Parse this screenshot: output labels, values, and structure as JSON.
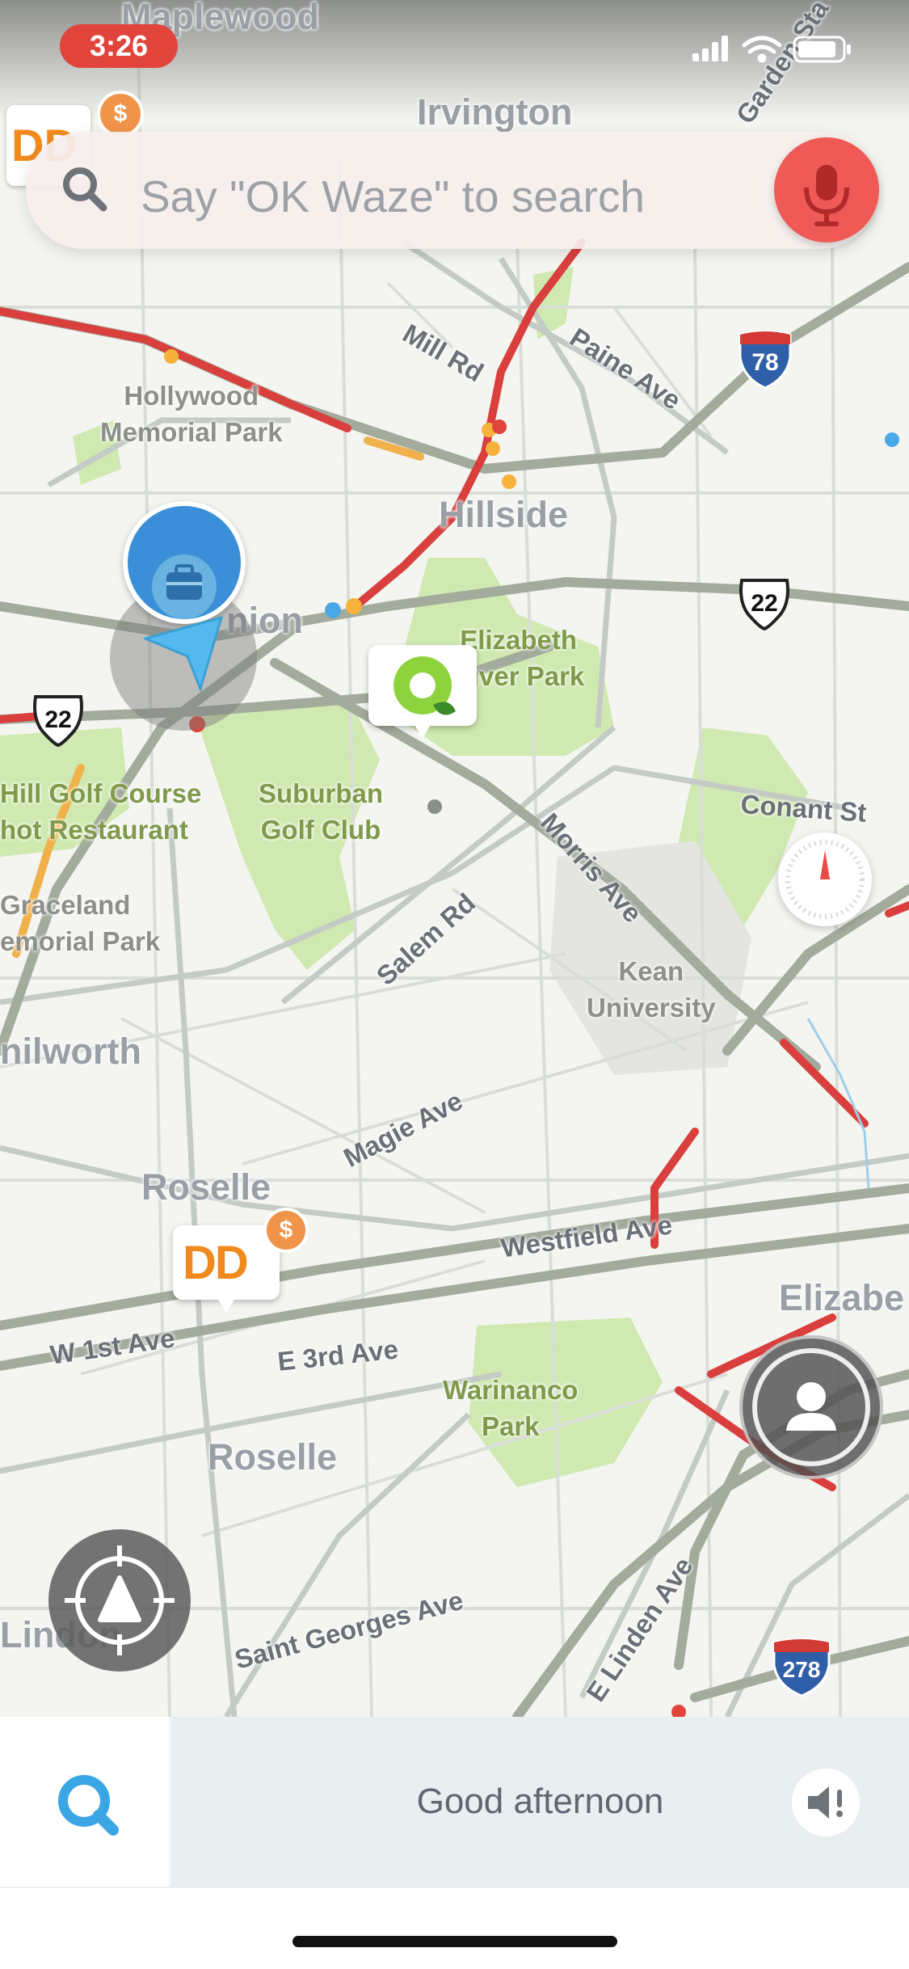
{
  "status_bar": {
    "time": "3:26"
  },
  "search_bar": {
    "placeholder": "Say \"OK Waze\" to search"
  },
  "map": {
    "cities": [
      "Maplewood",
      "Irvington",
      "Hillside",
      "nion",
      "nilworth",
      "Roselle",
      "Roselle",
      "Elizabe",
      "Lindon"
    ],
    "streets": [
      "Mill Rd",
      "Paine Ave",
      "Conant St",
      "Morris Ave",
      "Salem Rd",
      "Magie Ave",
      "Westfield Ave",
      "W 1st Ave",
      "E 3rd Ave",
      "Saint Georges Ave",
      "E Linden Ave",
      "Garden Sta"
    ],
    "parks": [
      "Elizabeth\nRiver Park",
      "Suburban\nGolf Club",
      "Warinanco\nPark",
      "Hill Golf Course\nhot Restaurant"
    ],
    "places": [
      "Hollywood\nMemorial Park",
      "Graceland\nemorial Park",
      "Kean\nUniversity"
    ],
    "shields": {
      "i78": "78",
      "us22_east": "22",
      "us22_west": "22",
      "i278": "278"
    },
    "pins": [
      "dunkin-dd",
      "quiznos-q",
      "work-briefcase"
    ],
    "dd_text": "DD",
    "dollar": "$"
  },
  "bottom_bar": {
    "greeting": "Good afternoon"
  },
  "colors": {
    "traffic_red": "#d9403d",
    "traffic_orange": "#f0b04a",
    "park_green": "#c9e8a8",
    "waze_blue": "#3da6e0"
  }
}
